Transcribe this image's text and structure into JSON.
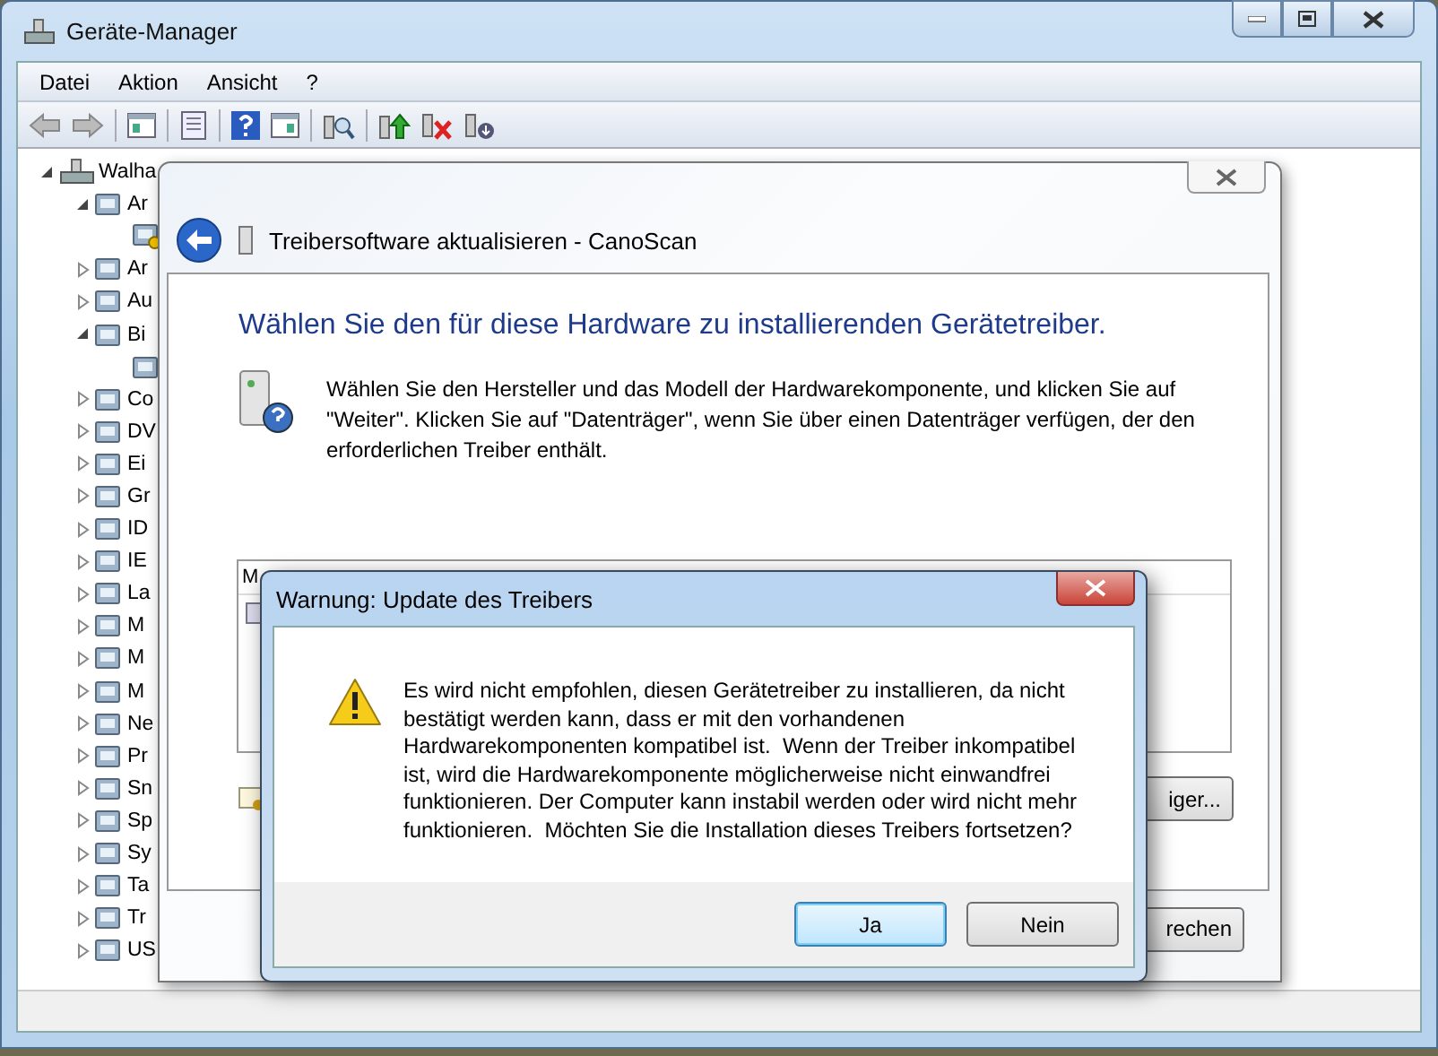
{
  "window": {
    "title": "Geräte-Manager"
  },
  "menu": [
    "Datei",
    "Aktion",
    "Ansicht",
    "?"
  ],
  "tree": {
    "label": "Walha",
    "expanded": true,
    "children": [
      {
        "label": "Ar",
        "expanded": true,
        "children": [
          {
            "warning": true
          }
        ]
      },
      {
        "label": "Ar",
        "expanded": false
      },
      {
        "label": "Au",
        "expanded": false
      },
      {
        "label": "Bi",
        "expanded": true,
        "children": [
          {
            "warning": false
          }
        ]
      },
      {
        "label": "Co",
        "expanded": false
      },
      {
        "label": "DV",
        "expanded": false
      },
      {
        "label": "Ei",
        "expanded": false
      },
      {
        "label": "Gr",
        "expanded": false
      },
      {
        "label": "ID",
        "expanded": false
      },
      {
        "label": "IE",
        "expanded": false
      },
      {
        "label": "La",
        "expanded": false
      },
      {
        "label": "M",
        "expanded": false
      },
      {
        "label": "M",
        "expanded": false
      },
      {
        "label": "M",
        "expanded": false
      },
      {
        "label": "Ne",
        "expanded": false
      },
      {
        "label": "Pr",
        "expanded": false
      },
      {
        "label": "Sn",
        "expanded": false
      },
      {
        "label": "Sp",
        "expanded": false
      },
      {
        "label": "Sy",
        "expanded": false
      },
      {
        "label": "Ta",
        "expanded": false
      },
      {
        "label": "Tr",
        "expanded": false
      },
      {
        "label": "US",
        "expanded": false
      }
    ]
  },
  "wizard": {
    "title": "Treibersoftware aktualisieren - CanoScan",
    "heading": "Wählen Sie den für diese Hardware zu installierenden Gerätetreiber.",
    "description": "Wählen Sie den Hersteller und das Modell der Hardwarekomponente, und klicken Sie auf\n\"Weiter\". Klicken Sie auf \"Datenträger\", wenn Sie über einen Datenträger verfügen, der den\nerforderlichen Treiber enthält.",
    "list_header": "M",
    "disk_button": "iger...",
    "cancel_button": "rechen"
  },
  "warning_dialog": {
    "title": "Warnung: Update des Treibers",
    "message": "Es wird nicht empfohlen, diesen Gerätetreiber zu installieren, da nicht\nbestätigt werden kann, dass er mit den vorhandenen\nHardwarekomponenten kompatibel ist.  Wenn der Treiber inkompatibel\nist, wird die Hardwarekomponente möglicherweise nicht einwandfrei\nfunktionieren. Der Computer kann instabil werden oder wird nicht mehr\nfunktionieren.  Möchten Sie die Installation dieses Treibers fortsetzen?",
    "buttons": [
      {
        "label": "Ja",
        "default": true
      },
      {
        "label": "Nein",
        "default": false
      }
    ]
  }
}
